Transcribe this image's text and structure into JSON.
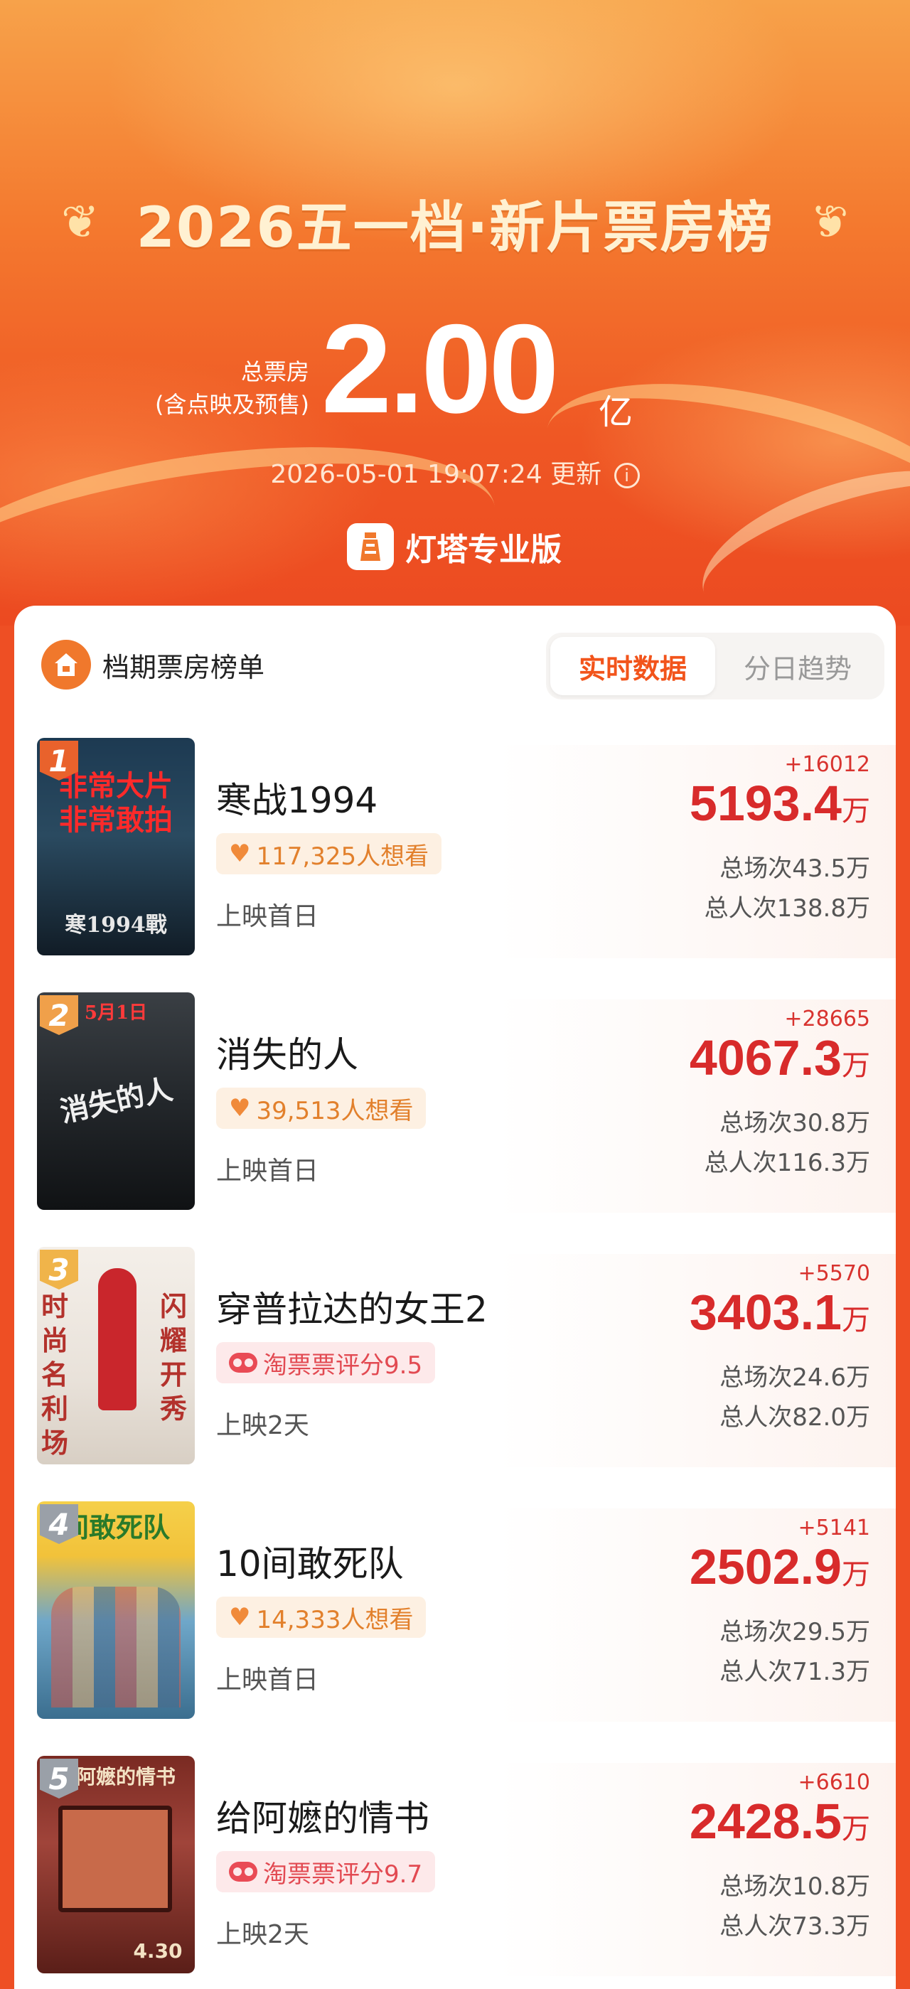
{
  "header": {
    "title": "2026五一档·新片票房榜",
    "total_label_line1": "总票房",
    "total_label_line2": "(含点映及预售)",
    "total_value": "2.00",
    "total_unit": "亿",
    "updated": "2026-05-01 19:07:24 更新",
    "brand": "灯塔专业版"
  },
  "card": {
    "title": "档期票房榜单",
    "tabs": [
      {
        "label": "实时数据",
        "active": true
      },
      {
        "label": "分日趋势",
        "active": false
      }
    ]
  },
  "movies": [
    {
      "rank": "1",
      "title": "寒战1994",
      "tag": "117,325人想看",
      "tag_type": "want",
      "release": "上映首日",
      "delta": "+16012",
      "box": "5193.4",
      "unit": "万",
      "shows": "总场次43.5万",
      "people": "总人次138.8万",
      "poster_text_top": "非常大片\n非常敢拍",
      "poster_text_bottom": "寒1994戰",
      "badge_color": "#e9622c"
    },
    {
      "rank": "2",
      "title": "消失的人",
      "tag": "39,513人想看",
      "tag_type": "want",
      "release": "上映首日",
      "delta": "+28665",
      "box": "4067.3",
      "unit": "万",
      "shows": "总场次30.8万",
      "people": "总人次116.3万",
      "poster_text_top": "5月1日",
      "poster_text_bottom": "消失的人",
      "badge_color": "#f0a04a"
    },
    {
      "rank": "3",
      "title": "穿普拉达的女王2",
      "tag": "淘票票评分9.5",
      "tag_type": "rating",
      "release": "上映2天",
      "delta": "+5570",
      "box": "3403.1",
      "unit": "万",
      "shows": "总场次24.6万",
      "people": "总人次82.0万",
      "poster_text_top": "闪耀开秀",
      "poster_text_bottom": "时尚名利场",
      "badge_color": "#f0b44a"
    },
    {
      "rank": "4",
      "title": "10间敢死队",
      "tag": "14,333人想看",
      "tag_type": "want",
      "release": "上映首日",
      "delta": "+5141",
      "box": "2502.9",
      "unit": "万",
      "shows": "总场次29.5万",
      "people": "总人次71.3万",
      "poster_text_top": "间敢死队",
      "poster_text_bottom": "",
      "badge_color": "#9aa0a8"
    },
    {
      "rank": "5",
      "title": "给阿嬷的情书",
      "tag": "淘票票评分9.7",
      "tag_type": "rating",
      "release": "上映2天",
      "delta": "+6610",
      "box": "2428.5",
      "unit": "万",
      "shows": "总场次10.8万",
      "people": "总人次73.3万",
      "poster_text_top": "给阿嬷的情书",
      "poster_text_bottom": "4.30",
      "badge_color": "#9aa0a8"
    }
  ],
  "colors": {
    "accent": "#f2541b",
    "box_red": "#d82b2b",
    "want_bg": "#fdf0e2",
    "rating_bg": "#fde9ea"
  },
  "icons": [
    "laurel-left-icon",
    "laurel-right-icon",
    "info-icon",
    "lighthouse-logo-icon",
    "ticket-house-icon",
    "heart-icon",
    "taopiaopiao-icon"
  ]
}
